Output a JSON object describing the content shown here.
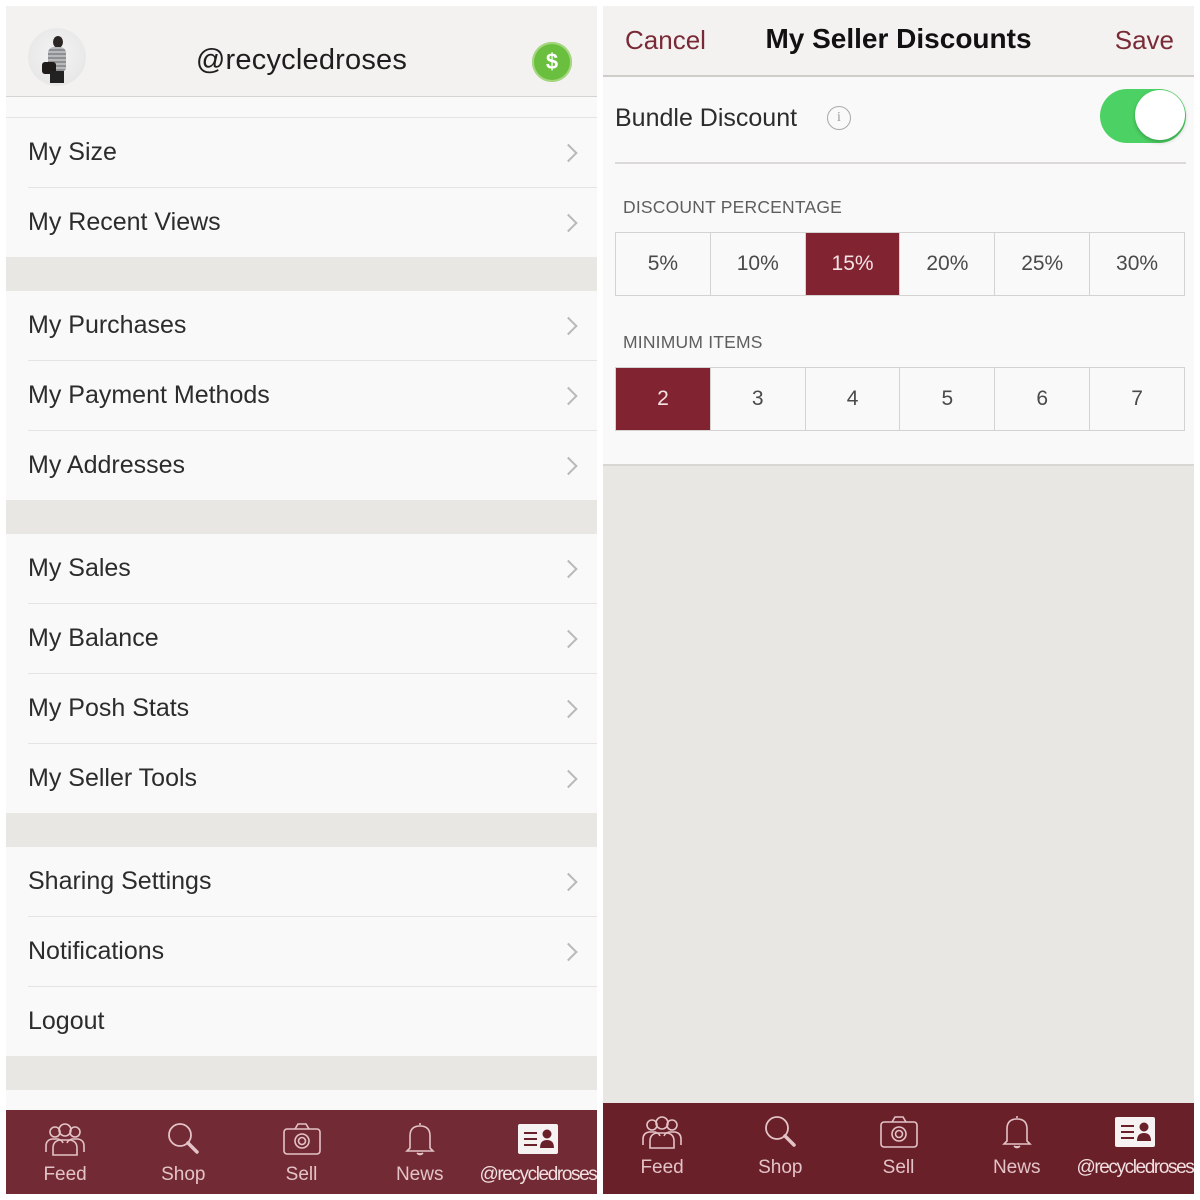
{
  "left": {
    "header": {
      "username": "@recycledroses",
      "balance_icon": "dollar-icon"
    },
    "groups": [
      {
        "items": [
          {
            "label": "My Size"
          },
          {
            "label": "My Recent Views"
          }
        ]
      },
      {
        "items": [
          {
            "label": "My Purchases"
          },
          {
            "label": "My Payment Methods"
          },
          {
            "label": "My Addresses"
          }
        ]
      },
      {
        "items": [
          {
            "label": "My Sales"
          },
          {
            "label": "My Balance"
          },
          {
            "label": "My Posh Stats"
          },
          {
            "label": "My Seller Tools"
          }
        ]
      },
      {
        "items": [
          {
            "label": "Sharing Settings",
            "chevron": true
          },
          {
            "label": "Notifications",
            "chevron": true
          },
          {
            "label": "Logout",
            "chevron": false
          }
        ]
      }
    ],
    "tabbar": {
      "tabs": [
        {
          "label": "Feed",
          "icon": "feed-icon"
        },
        {
          "label": "Shop",
          "icon": "search-icon"
        },
        {
          "label": "Sell",
          "icon": "camera-icon"
        },
        {
          "label": "News",
          "icon": "bell-icon"
        },
        {
          "label": "@recycledroses",
          "icon": "profile-card-icon",
          "active": true
        }
      ]
    }
  },
  "right": {
    "header": {
      "cancel": "Cancel",
      "title": "My Seller Discounts",
      "save": "Save"
    },
    "bundle": {
      "label": "Bundle Discount",
      "enabled": true
    },
    "discount": {
      "label": "DISCOUNT PERCENTAGE",
      "options": [
        "5%",
        "10%",
        "15%",
        "20%",
        "25%",
        "30%"
      ],
      "selected": "15%"
    },
    "min_items": {
      "label": "MINIMUM ITEMS",
      "options": [
        "2",
        "3",
        "4",
        "5",
        "6",
        "7"
      ],
      "selected": "2"
    },
    "tabbar": {
      "tabs": [
        {
          "label": "Feed",
          "icon": "feed-icon"
        },
        {
          "label": "Shop",
          "icon": "search-icon"
        },
        {
          "label": "Sell",
          "icon": "camera-icon"
        },
        {
          "label": "News",
          "icon": "bell-icon"
        },
        {
          "label": "@recycledroses",
          "icon": "profile-card-icon",
          "active": true
        }
      ]
    }
  },
  "colors": {
    "brand": "#722b34",
    "selected_segment": "#822331",
    "toggle_on": "#4cd264",
    "balance_green": "#6bbf3f"
  }
}
